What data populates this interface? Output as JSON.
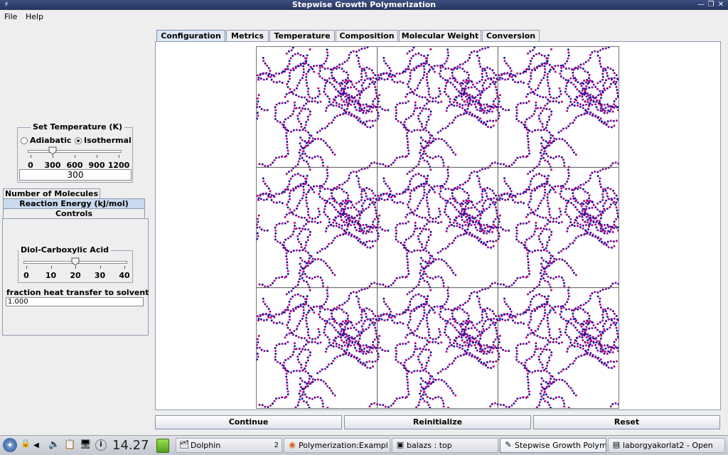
{
  "window": {
    "title": "Stepwise Growth Polymerization",
    "buttons": {
      "minimize": "—",
      "maximize": "❐",
      "close": "✕"
    }
  },
  "menubar": {
    "items": [
      "File",
      "Help"
    ]
  },
  "temperature": {
    "legend": "Set Temperature (K)",
    "radio_adiabatic": "Adiabatic",
    "radio_isothermal": "Isothermal",
    "selected_mode": "Isothermal",
    "slider_value": 300,
    "slider_min": 0,
    "slider_max": 1200,
    "ticks": [
      "0",
      "300",
      "600",
      "900",
      "1200"
    ],
    "value_field": "300"
  },
  "left_tabs": [
    "Number of Molecules",
    "Reaction Energy (kJ/mol)",
    "Controls"
  ],
  "controls": {
    "legend": "Diol-Carboxylic Acid",
    "slider_value": 20,
    "slider_min": 0,
    "slider_max": 40,
    "ticks": [
      "0",
      "10",
      "20",
      "30",
      "40"
    ],
    "heat_label": "fraction heat transfer to solvent",
    "heat_value": "1.000"
  },
  "tabs": [
    "Configuration",
    "Metrics",
    "Temperature",
    "Composition",
    "Molecular Weight",
    "Conversion"
  ],
  "active_tab": "Configuration",
  "buttons": {
    "continue": "Continue",
    "reinitialize": "Reinitialize",
    "reset": "Reset"
  },
  "colors": {
    "atom_a": "#b0007a",
    "atom_b": "#1a1aa8",
    "panel_tab_active": "#dde7f4"
  },
  "taskbar": {
    "clock": "14.27",
    "pager": "2",
    "tasks": [
      {
        "label": "Dolphin",
        "icon": "folder-icon"
      },
      {
        "label": "Polymerization:Exampl",
        "icon": "firefox-icon"
      },
      {
        "label": "balazs : top",
        "icon": "terminal-icon"
      },
      {
        "label": "Stepwise Growth Polym",
        "icon": "java-app-icon",
        "active": true
      },
      {
        "label": "laborgyakorlat2 - Open",
        "icon": "document-icon"
      }
    ]
  }
}
